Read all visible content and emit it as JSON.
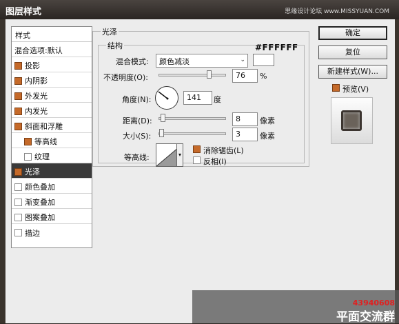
{
  "window": {
    "title": "图层样式",
    "watermark": "思缘设计论坛 www.MISSYUAN.COM"
  },
  "styles_panel": {
    "header": "样式",
    "blend_options": "混合选项:默认",
    "items": [
      {
        "label": "投影",
        "checked": true
      },
      {
        "label": "内阴影",
        "checked": true
      },
      {
        "label": "外发光",
        "checked": true
      },
      {
        "label": "内发光",
        "checked": true
      },
      {
        "label": "斜面和浮雕",
        "checked": true
      },
      {
        "label": "等高线",
        "checked": true
      },
      {
        "label": "纹理",
        "checked": false
      },
      {
        "label": "光泽",
        "checked": true
      },
      {
        "label": "颜色叠加",
        "checked": false
      },
      {
        "label": "渐变叠加",
        "checked": false
      },
      {
        "label": "图案叠加",
        "checked": false
      },
      {
        "label": "描边",
        "checked": false
      }
    ],
    "selected": "光泽"
  },
  "satin": {
    "title": "光泽",
    "structure": "结构",
    "color_hex": "#FFFFFF",
    "blend_mode_label": "混合模式:",
    "blend_mode_value": "颜色减淡",
    "opacity_label": "不透明度(O):",
    "opacity_value": "76",
    "opacity_unit": "%",
    "angle_label": "角度(N):",
    "angle_value": "141",
    "angle_unit": "度",
    "distance_label": "距离(D):",
    "distance_value": "8",
    "size_label": "大小(S):",
    "size_value": "3",
    "px_unit": "像素",
    "contour_label": "等高线:",
    "antialias_label": "消除锯齿(L)",
    "antialias_checked": true,
    "invert_label": "反相(I)",
    "invert_checked": false,
    "opacity_percent": 76
  },
  "buttons": {
    "ok": "确定",
    "reset": "复位",
    "new_style": "新建样式(W)...",
    "preview_label": "预览(V)",
    "preview_checked": true
  },
  "overlay": {
    "number": "43940608",
    "text": "平面交流群"
  },
  "colors": {
    "accent_checkbox": "#c56a2a",
    "selected_row": "#3a3a3a"
  }
}
